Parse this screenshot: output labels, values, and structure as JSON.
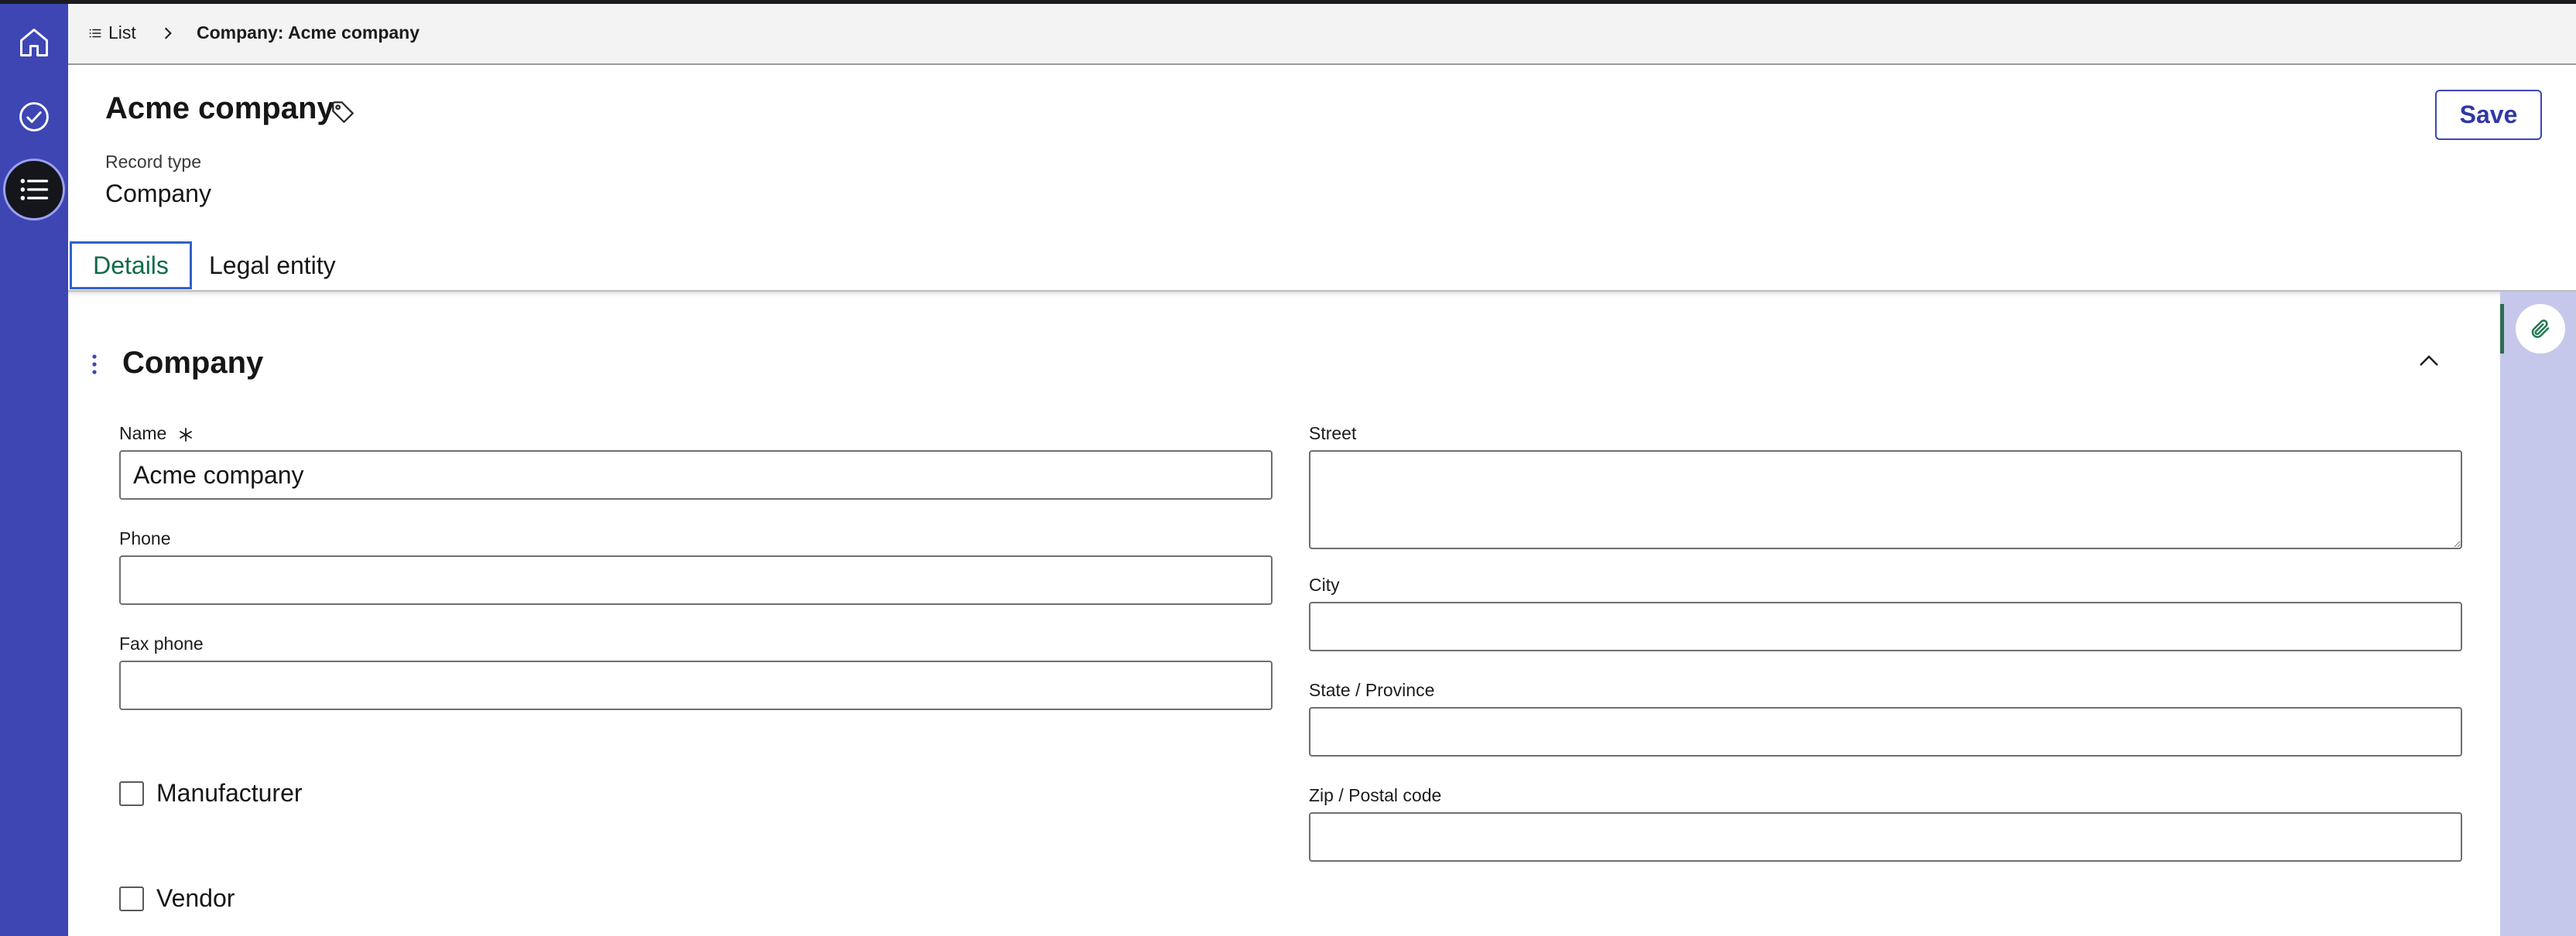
{
  "breadcrumb": {
    "list_label": "List",
    "current": "Company: Acme company"
  },
  "header": {
    "title": "Acme company",
    "record_type_label": "Record type",
    "record_type_value": "Company",
    "save_label": "Save"
  },
  "tabs": [
    {
      "label": "Details",
      "active": true
    },
    {
      "label": "Legal entity",
      "active": false
    }
  ],
  "section": {
    "title": "Company",
    "left_fields": [
      {
        "label": "Name",
        "value": "Acme company",
        "required": true
      },
      {
        "label": "Phone",
        "value": ""
      },
      {
        "label": "Fax phone",
        "value": ""
      }
    ],
    "right_fields": [
      {
        "label": "Street",
        "value": ""
      },
      {
        "label": "City",
        "value": ""
      },
      {
        "label": "State / Province",
        "value": ""
      },
      {
        "label": "Zip / Postal code",
        "value": ""
      }
    ],
    "checkboxes": [
      {
        "label": "Manufacturer",
        "checked": false
      },
      {
        "label": "Vendor",
        "checked": false
      }
    ]
  },
  "icons": {
    "rail": [
      "home-icon",
      "check-circle-icon",
      "list-icon"
    ],
    "tag": "tag-icon",
    "attach": "paperclip-icon",
    "collapse": "chevron-up-icon",
    "drag": "drag-handle-icon"
  },
  "colors": {
    "rail": "#3d46b3",
    "accent": "#2f38a5",
    "active_tab_text": "#0f6b45",
    "util_panel": "#c5c8eb"
  }
}
